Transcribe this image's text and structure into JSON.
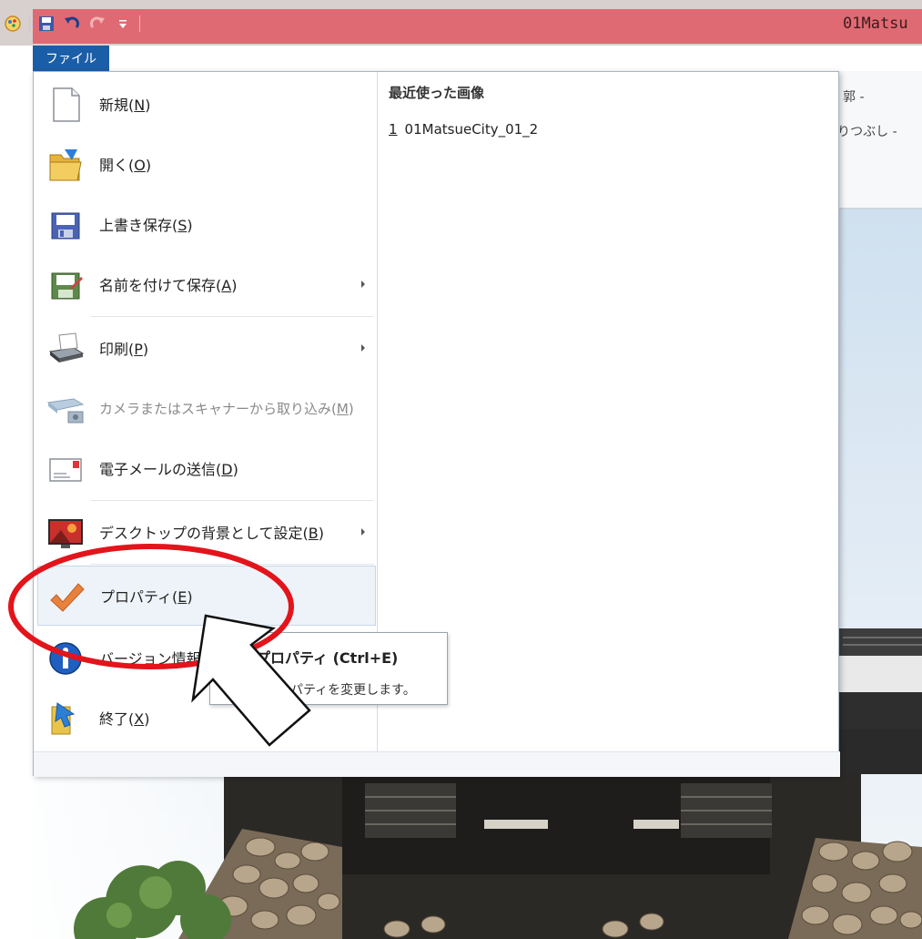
{
  "window": {
    "title": "01Matsu",
    "quick_access_icons": [
      "app-icon",
      "save-icon",
      "undo-icon",
      "redo-icon",
      "customize-dropdown-icon"
    ]
  },
  "ribbon": {
    "file_tab": "ファイル",
    "partial_items": [
      "郭 -",
      "りつぶし -"
    ]
  },
  "file_menu": {
    "items": [
      {
        "icon": "new-document-icon",
        "label": "新規(",
        "key": "N",
        "tail": ")",
        "submenu": false,
        "enabled": true
      },
      {
        "icon": "open-folder-icon",
        "label": "開く(",
        "key": "O",
        "tail": ")",
        "submenu": false,
        "enabled": true
      },
      {
        "icon": "save-disk-icon",
        "label": "上書き保存(",
        "key": "S",
        "tail": ")",
        "submenu": false,
        "enabled": true
      },
      {
        "icon": "save-as-icon",
        "label": "名前を付けて保存(",
        "key": "A",
        "tail": ")",
        "submenu": true,
        "enabled": true
      },
      {
        "icon": "printer-icon",
        "label": "印刷(",
        "key": "P",
        "tail": ")",
        "submenu": true,
        "enabled": true
      },
      {
        "icon": "scanner-icon",
        "label": "カメラまたはスキャナーから取り込み(",
        "key": "M",
        "tail": ")",
        "submenu": false,
        "enabled": false
      },
      {
        "icon": "email-icon",
        "label": "電子メールの送信(",
        "key": "D",
        "tail": ")",
        "submenu": false,
        "enabled": true
      },
      {
        "icon": "desktop-background-icon",
        "label": "デスクトップの背景として設定(",
        "key": "B",
        "tail": ")",
        "submenu": true,
        "enabled": true
      },
      {
        "icon": "checkmark-icon",
        "label": "プロパティ(",
        "key": "E",
        "tail": ")",
        "submenu": false,
        "enabled": true,
        "highlighted": true
      },
      {
        "icon": "info-icon",
        "label": "バージョン情報(",
        "key": "A",
        "tail": ")",
        "submenu": false,
        "enabled": true
      },
      {
        "icon": "exit-icon",
        "label": "終了(",
        "key": "X",
        "tail": ")",
        "submenu": false,
        "enabled": true
      }
    ],
    "recent_title": "最近使った画像",
    "recent_items": [
      {
        "num": "1",
        "name": "01MatsueCity_01_2"
      }
    ]
  },
  "tooltip": {
    "title": "プロパティ (Ctrl+E)",
    "description": "画像のプロパティを変更します。"
  },
  "colors": {
    "title_bar": "#e06a73",
    "file_tab": "#1b5ea8",
    "highlight_ring": "#e3141b"
  }
}
